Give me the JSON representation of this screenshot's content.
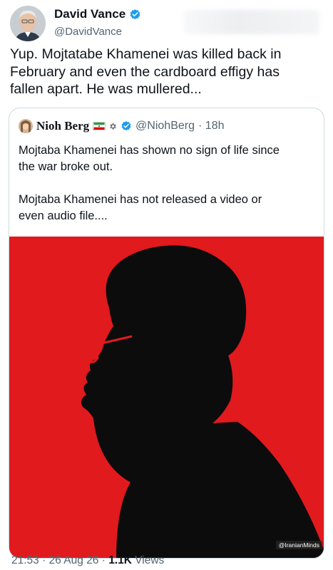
{
  "tweet": {
    "author_name": "David Vance",
    "handle": "@DavidVance",
    "verified_color": "#1d9bf0",
    "text": "Yup. Mojtatabe Khamenei was killed back in\nFebruary and even the cardboard effigy has\nfallen apart. He was mullered...",
    "time": "21:53",
    "separator": " · ",
    "date": "26 Aug 26",
    "views_count": "1.1K",
    "views_label": " Views"
  },
  "quote": {
    "author_name": "Nioh Berg",
    "star_glyph": "✡",
    "handle": "@NiohBerg",
    "time_ago": "· 18h",
    "text": "Mojtaba Khamenei has shown no sign of life since\nthe war broke out.\n\nMojtaba Khamenei has not released a video or\neven audio file....",
    "image_background": "#e11a1e",
    "watermark": "@IranianMinds"
  }
}
